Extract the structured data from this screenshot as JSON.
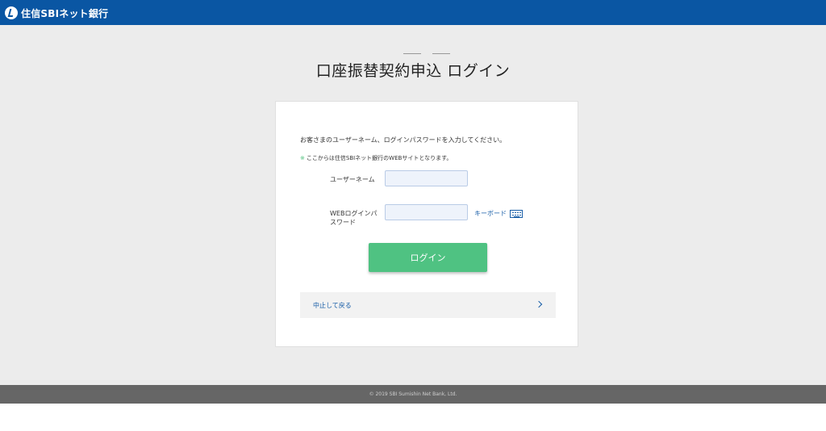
{
  "header": {
    "brand": "住信SBIネット銀行",
    "logo_icon": "sbi-logo-icon",
    "bg_color": "#0a56a3"
  },
  "page": {
    "title": "口座振替契約申込 ログイン"
  },
  "form": {
    "instruction": "お客さまのユーザーネーム、ログインパスワードを入力してください。",
    "note_mark": "※",
    "note": "ここからは住信SBIネット銀行のWEBサイトとなります。",
    "username_label": "ユーザーネーム",
    "username_value": "",
    "password_label_line1": "WEBログインパ",
    "password_label_line2": "スワード",
    "password_value": "",
    "keyboard_label": "キーボード",
    "keyboard_icon": "keyboard-icon",
    "login_button": "ログイン",
    "login_color": "#4fc282",
    "cancel_label": "中止して戻る",
    "cancel_icon": "chevron-right-icon"
  },
  "footer": {
    "copyright": "© 2019 SBI Sumishin Net Bank, Ltd."
  }
}
